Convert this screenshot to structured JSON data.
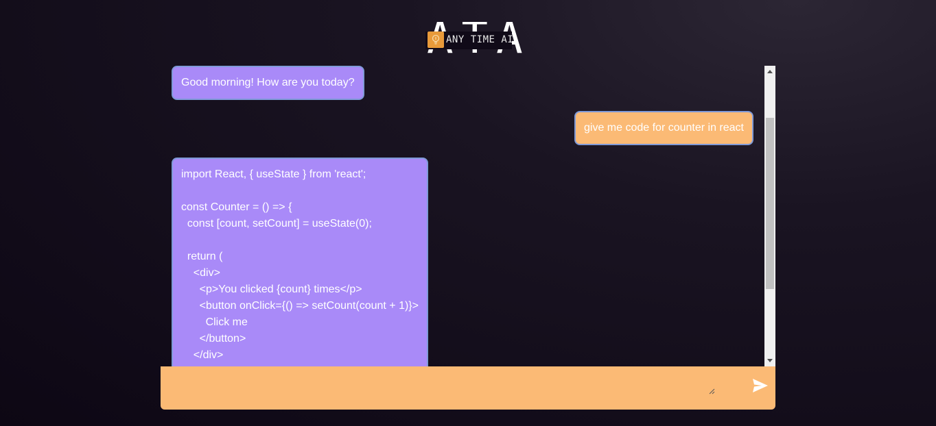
{
  "header": {
    "logo_letters": "ATA",
    "logo_subtitle": "ANY TIME AI",
    "logo_icon": "lightbulb-icon"
  },
  "messages": [
    {
      "role": "bot",
      "text": "Good morning! How are you today?"
    },
    {
      "role": "user",
      "text": "give me code for counter in react"
    },
    {
      "role": "bot",
      "lines": [
        "import React, { useState } from 'react';",
        "",
        "const Counter = () => {",
        "  const [count, setCount] = useState(0);",
        "",
        "  return (",
        "    <div>",
        "      <p>You clicked {count} times</p>",
        "      <button onClick={() => setCount(count + 1)}>",
        "        Click me",
        "      </button>",
        "    </div>"
      ]
    }
  ],
  "input": {
    "value": "",
    "send_icon": "send-icon"
  },
  "colors": {
    "bot_bubble": "#a98af8",
    "user_bubble": "#fbba75",
    "bubble_border": "#7f9ad8",
    "input_bar": "#fbba75"
  }
}
